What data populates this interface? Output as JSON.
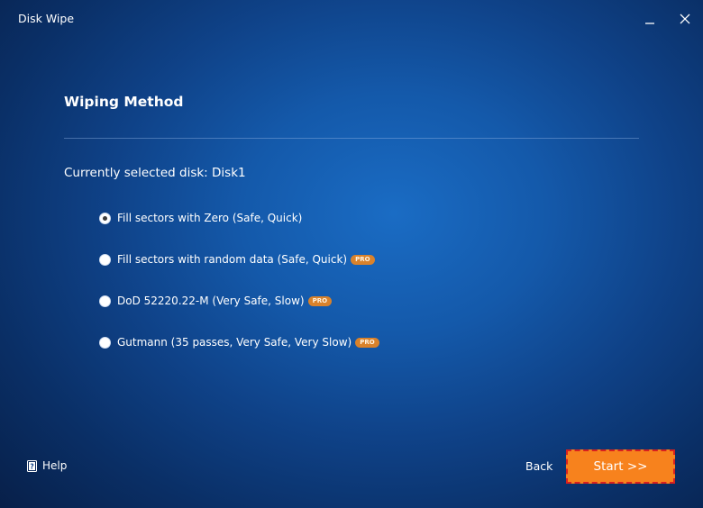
{
  "window": {
    "title": "Disk Wipe"
  },
  "main": {
    "heading": "Wiping Method",
    "selected_disk": "Currently selected disk: Disk1",
    "options": [
      {
        "label": "Fill sectors with Zero (Safe, Quick)",
        "selected": true,
        "pro": false
      },
      {
        "label": "Fill sectors with random data (Safe, Quick)",
        "selected": false,
        "pro": true
      },
      {
        "label": "DoD 52220.22-M (Very Safe, Slow)",
        "selected": false,
        "pro": true
      },
      {
        "label": "Gutmann (35 passes, Very Safe, Very Slow)",
        "selected": false,
        "pro": true
      }
    ],
    "pro_badge": "PRO"
  },
  "footer": {
    "help_label": "Help",
    "help_icon": "help-book-icon",
    "back_label": "Back",
    "start_label": "Start >>"
  },
  "colors": {
    "background": "#1459aa",
    "start_button": "#f7821d",
    "pro_badge": "#d9822b",
    "highlight_border": "#d81f1f"
  }
}
